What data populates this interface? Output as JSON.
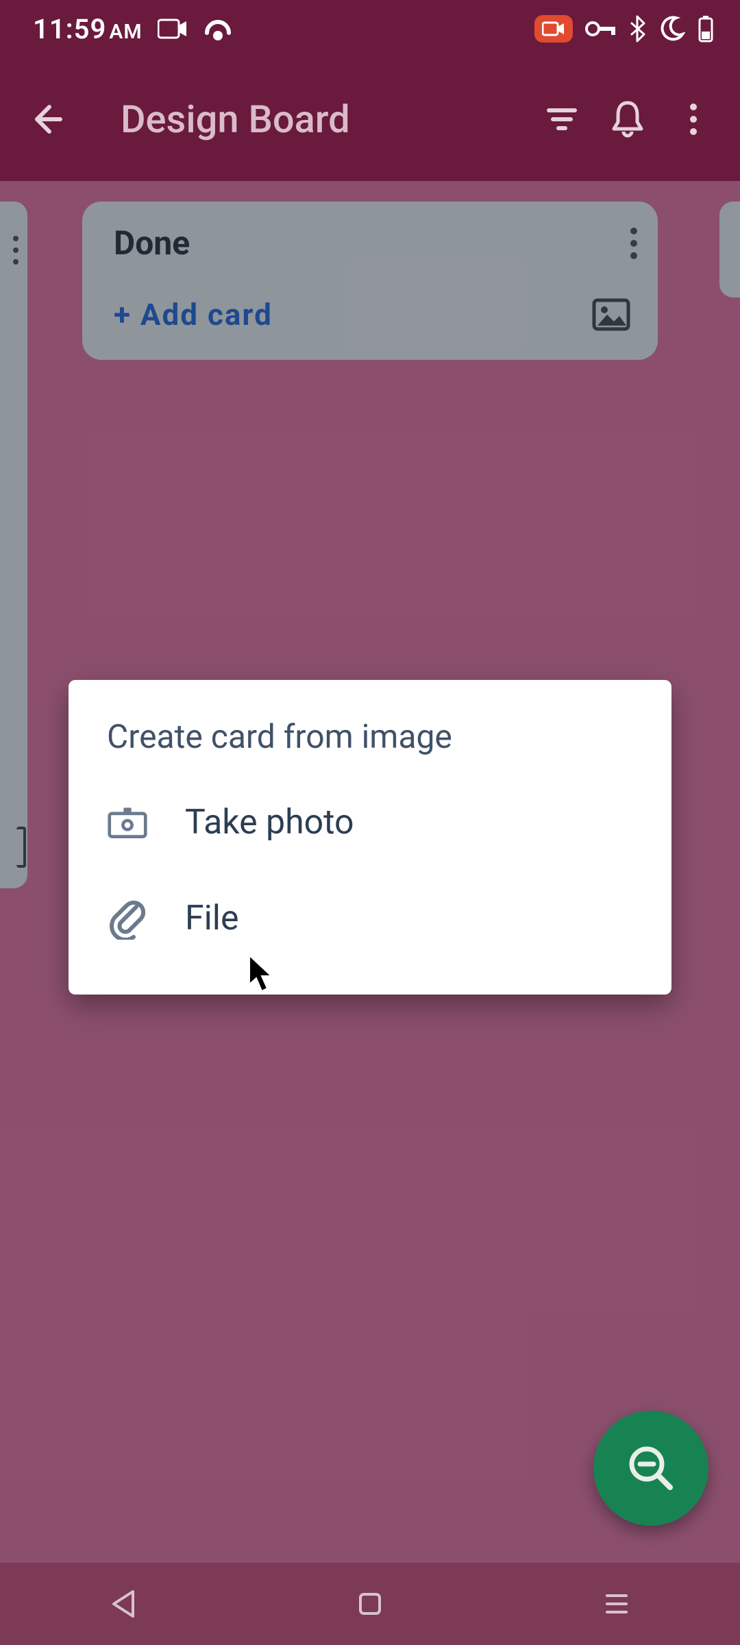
{
  "status": {
    "time": "11:59",
    "ampm": "AM"
  },
  "appbar": {
    "title": "Design Board"
  },
  "list": {
    "title": "Done",
    "add_card": "+ Add card"
  },
  "dialog": {
    "title": "Create card from image",
    "take_photo": "Take photo",
    "file": "File"
  }
}
